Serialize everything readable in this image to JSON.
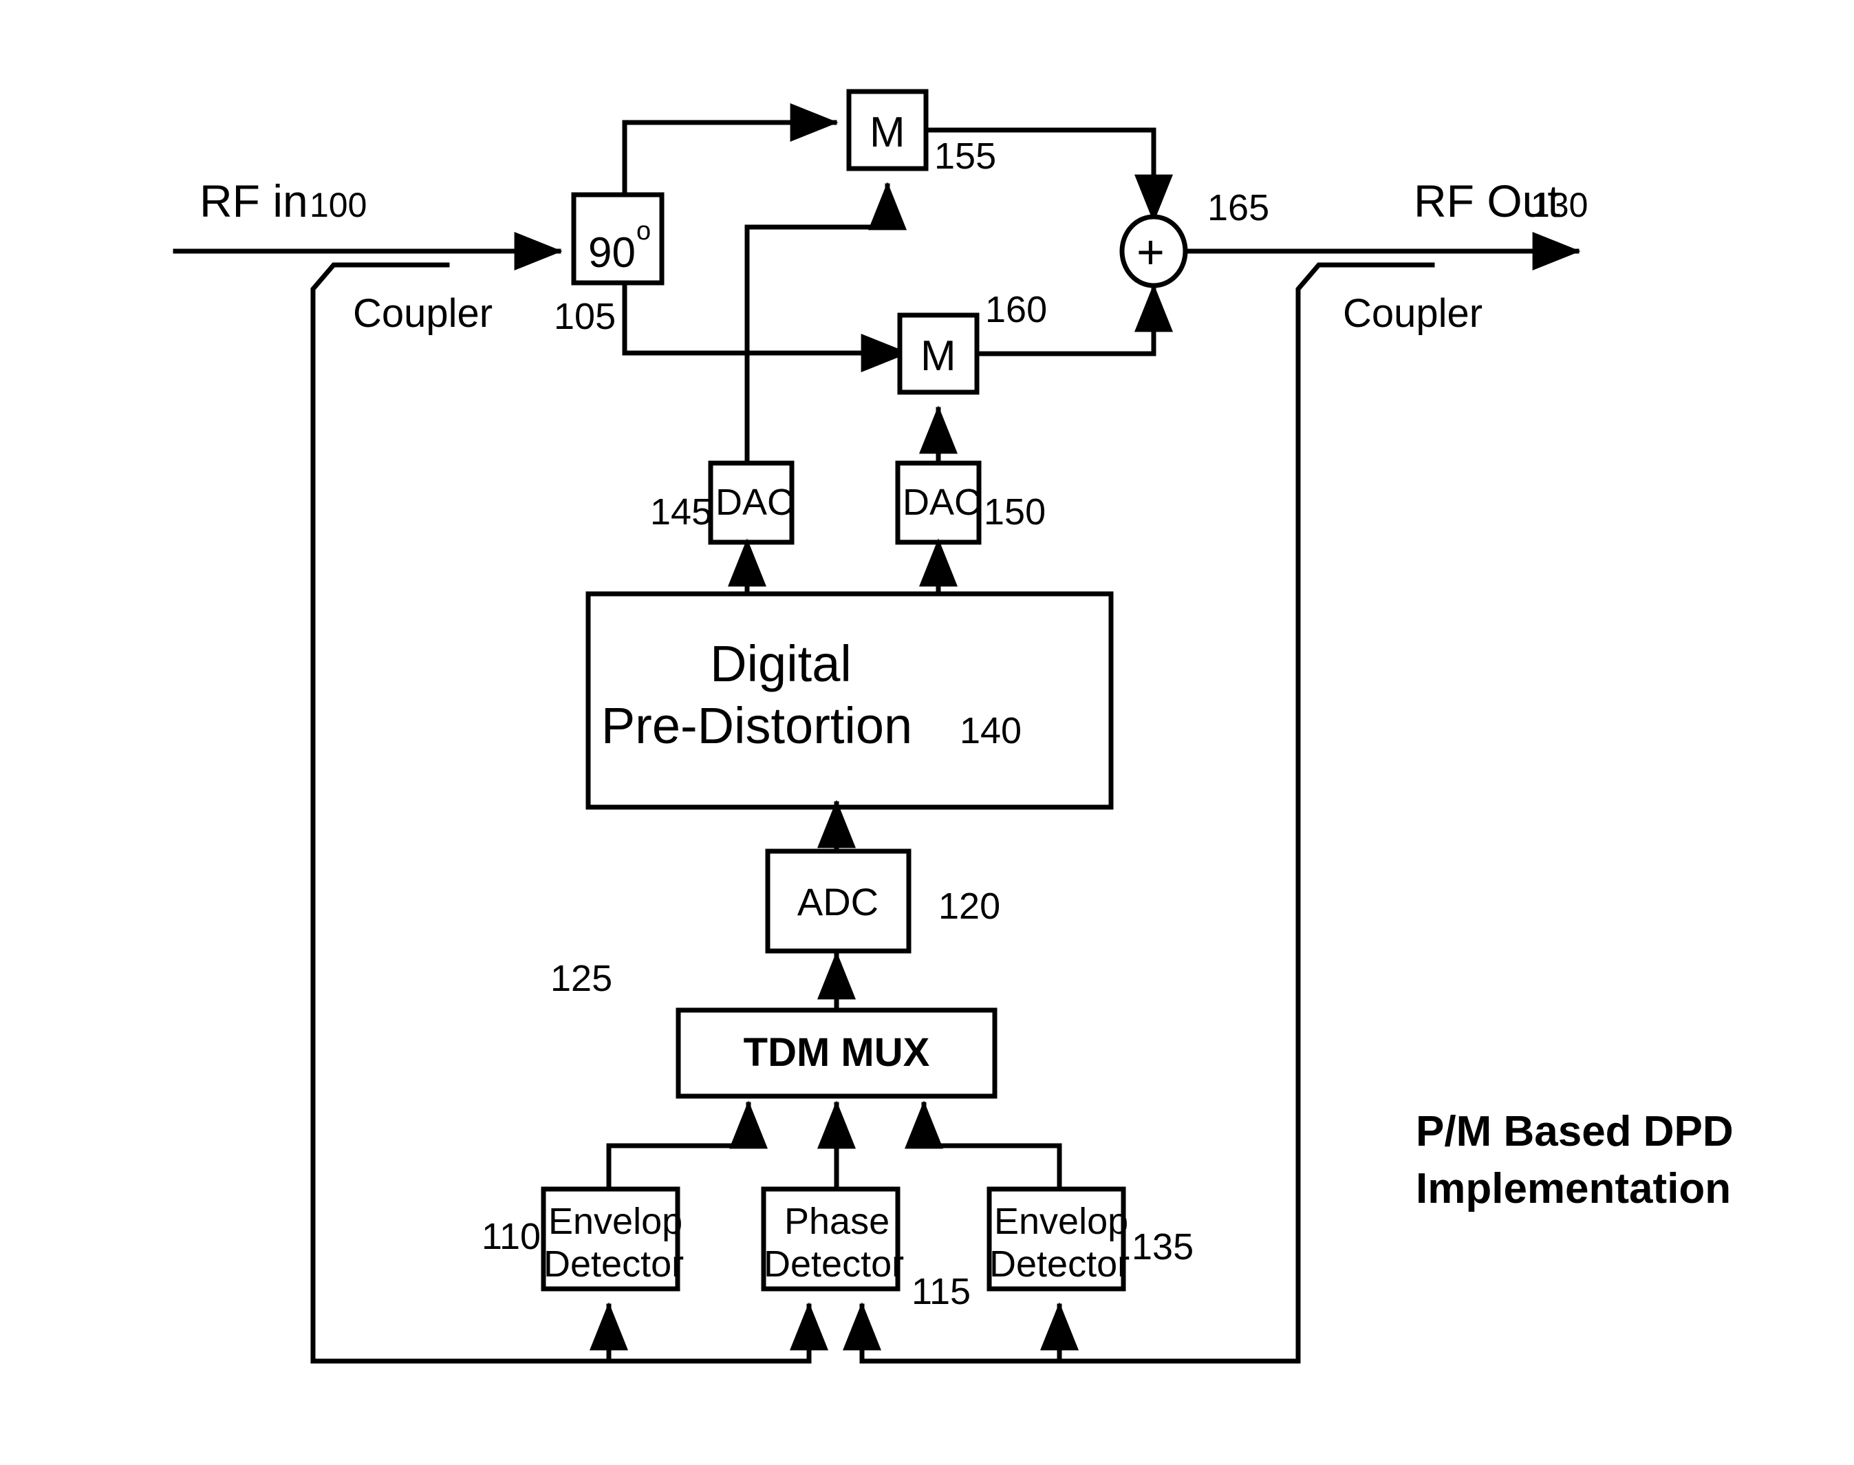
{
  "figure": {
    "caption_line1": "P/M Based DPD",
    "caption_line2": "Implementation"
  },
  "io": {
    "rf_in_label": "RF in",
    "rf_in_ref": "100",
    "rf_out_label": "RF Out",
    "rf_out_ref": "130",
    "coupler_left_label": "Coupler",
    "coupler_right_label": "Coupler"
  },
  "blocks": {
    "hybrid": {
      "label": "90",
      "superscript": "o",
      "ref": "105"
    },
    "mixer_top": {
      "label": "M",
      "ref": "155"
    },
    "mixer_bottom": {
      "label": "M",
      "ref": "160"
    },
    "summer": {
      "label": "+",
      "ref": "165"
    },
    "dac_left": {
      "label": "DAC",
      "ref": "145"
    },
    "dac_right": {
      "label": "DAC",
      "ref": "150"
    },
    "dpd": {
      "line1": "Digital",
      "line2": "Pre-Distortion",
      "ref": "140"
    },
    "adc": {
      "label": "ADC",
      "ref": "120"
    },
    "tdm_mux": {
      "label": "TDM MUX",
      "ref": "125"
    },
    "envelope_detector_left": {
      "line1": "Envelop",
      "line2": "Detector",
      "ref": "110"
    },
    "phase_detector": {
      "line1": "Phase",
      "line2": "Detector",
      "ref": "115"
    },
    "envelope_detector_right": {
      "line1": "Envelop",
      "line2": "Detector",
      "ref": "135"
    }
  },
  "colors": {
    "ink": "#000000",
    "paper": "#ffffff"
  }
}
